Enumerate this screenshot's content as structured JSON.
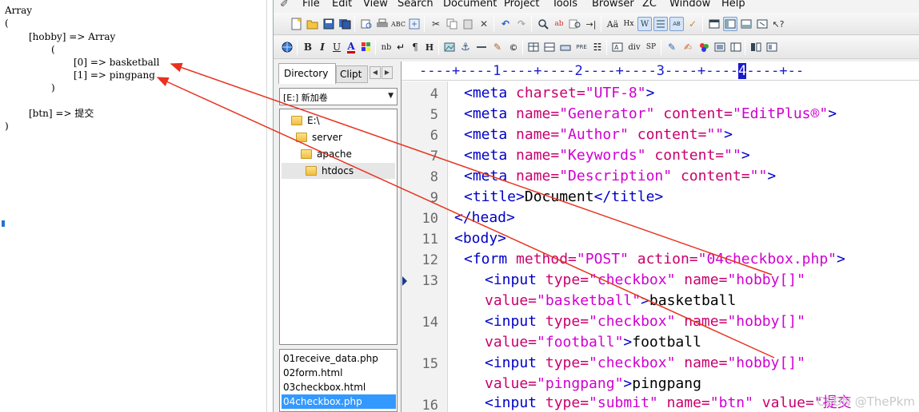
{
  "output": {
    "lines": [
      "Array",
      "(",
      "[hobby] => Array",
      "(",
      "[0] => basketball",
      "[1] => pingpang",
      ")",
      "[btn] => 提交",
      ")"
    ]
  },
  "menubar": {
    "items": [
      "File",
      "Edit",
      "View",
      "Search",
      "Document",
      "Project",
      "Tools",
      "Browser",
      "ZC",
      "Window",
      "Help"
    ]
  },
  "toolbar2": {
    "text_buttons": [
      "B",
      "I",
      "U",
      "A",
      "nb",
      "¶",
      "H",
      "div",
      "SP"
    ]
  },
  "side_panel": {
    "tabs": [
      "Directory",
      "Clipt"
    ],
    "drive": "[E:] 新加卷",
    "tree": [
      "E:\\",
      "server",
      "apache",
      "htdocs"
    ],
    "files": [
      "01receive_data.php",
      "02form.html",
      "03checkbox.html",
      "04checkbox.php"
    ]
  },
  "editor": {
    "ruler": "----+----1----+----2----+----3----+----4----+--",
    "ruler_cursor_col": "4",
    "line_numbers": [
      "4",
      "5",
      "6",
      "7",
      "8",
      "9",
      "10",
      "11",
      "12",
      "13",
      "14",
      "15",
      "16"
    ],
    "current_line": "13",
    "code": {
      "l4": [
        "<meta ",
        "charset=",
        "\"UTF-8\"",
        ">"
      ],
      "l5": [
        "<meta ",
        "name=",
        "\"Generator\"",
        " content=",
        "\"EditPlus®\"",
        ">"
      ],
      "l6": [
        "<meta ",
        "name=",
        "\"Author\"",
        " content=",
        "\"\"",
        ">"
      ],
      "l7": [
        "<meta ",
        "name=",
        "\"Keywords\"",
        " content=",
        "\"\"",
        ">"
      ],
      "l8": [
        "<meta ",
        "name=",
        "\"Description\"",
        " content=",
        "\"\"",
        ">"
      ],
      "l9": [
        "<title>",
        "Document",
        "</title>"
      ],
      "l10": [
        "</head>"
      ],
      "l11": [
        "<body>"
      ],
      "l12": [
        "<form ",
        "method=",
        "\"POST\"",
        " action=",
        "\"04checkbox.php\"",
        ">"
      ],
      "l13a": [
        "<input ",
        "type=",
        "\"checkbox\"",
        " name=",
        "\"hobby[]\""
      ],
      "l13b": [
        "value=",
        "\"basketball\"",
        ">",
        "basketball"
      ],
      "l14a": [
        "<input ",
        "type=",
        "\"checkbox\"",
        " name=",
        "\"hobby[]\""
      ],
      "l14b": [
        "value=",
        "\"football\"",
        ">",
        "football"
      ],
      "l15a": [
        "<input ",
        "type=",
        "\"checkbox\"",
        " name=",
        "\"hobby[]\""
      ],
      "l15b": [
        "value=",
        "\"pingpang\"",
        ">",
        "pingpang"
      ],
      "l16": [
        "<input ",
        "type=",
        "\"submit\"",
        " name=",
        "\"btn\"",
        " value=",
        "\"提交"
      ]
    },
    "watermark": "CSDN @ThePkm"
  },
  "colors": {
    "tag": "#0000c8",
    "attribute": "#c8006e",
    "value": "#d000d0",
    "arrow": "#e8321e",
    "selection": "#3399ff"
  }
}
